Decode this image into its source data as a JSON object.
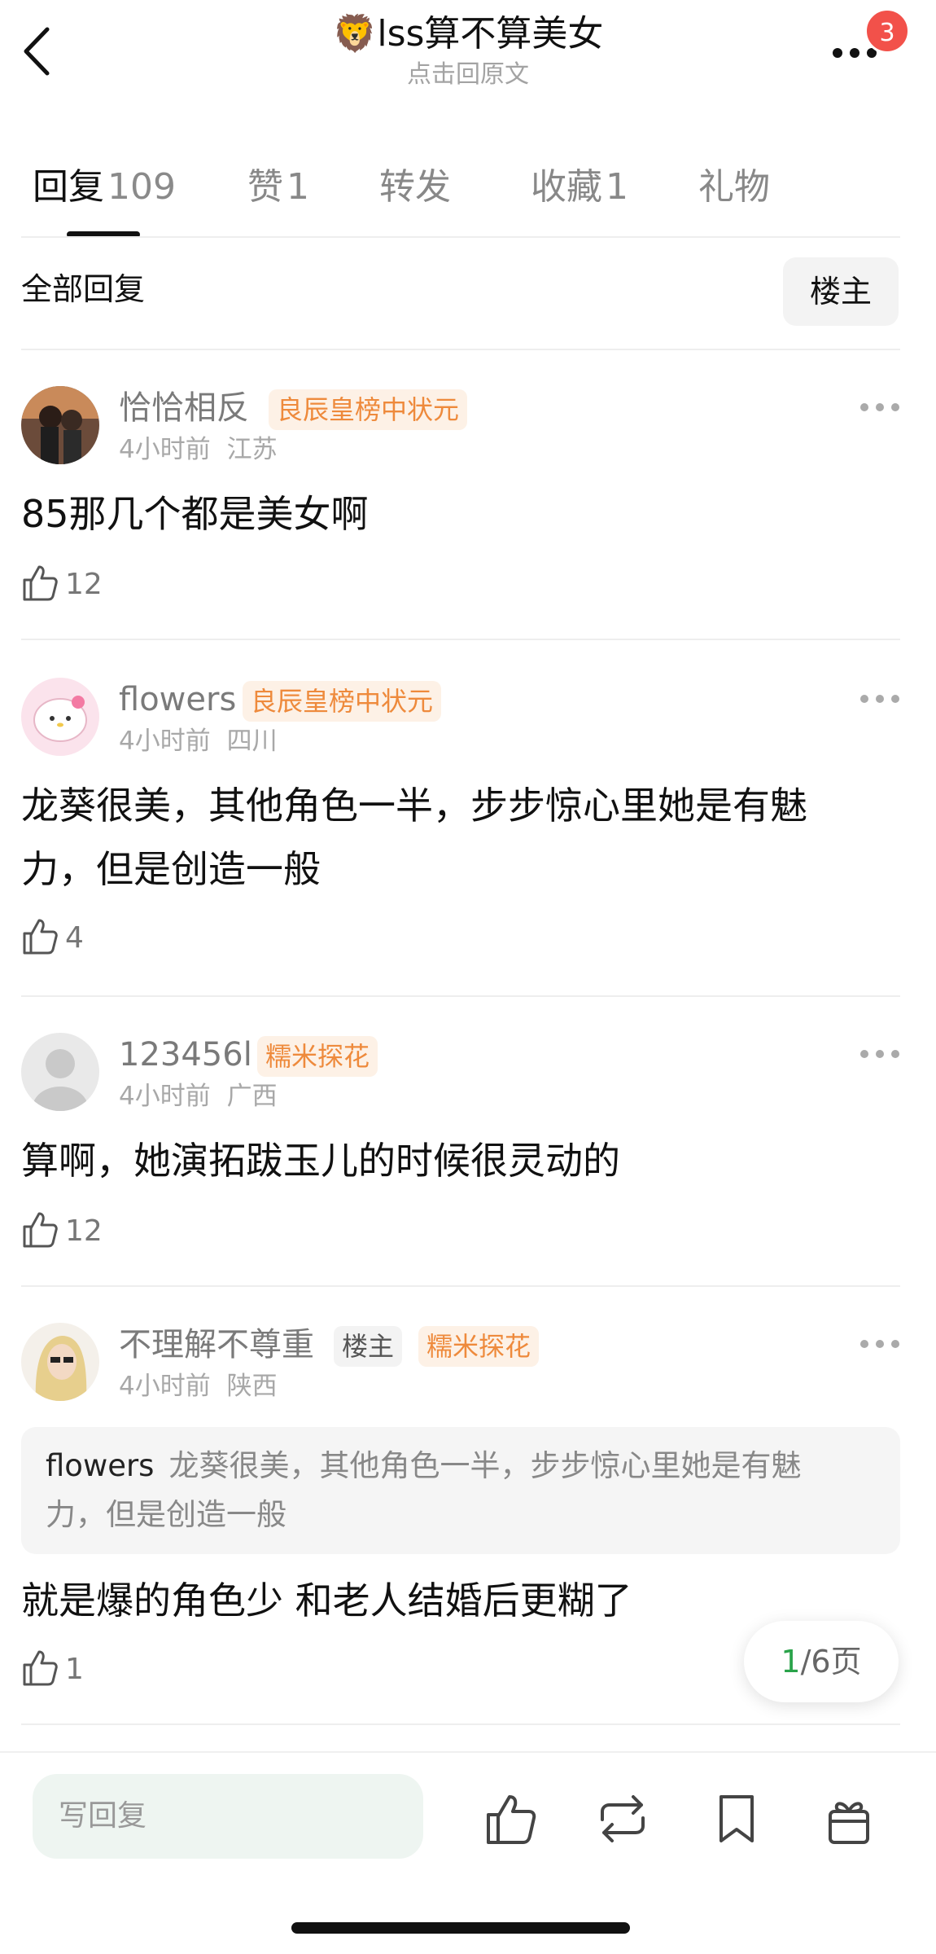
{
  "header": {
    "title_emoji": "🦁",
    "title_text": "lss算不算美女",
    "subtitle": "点击回原文",
    "notification_count": "3"
  },
  "tabs": [
    {
      "label": "回复",
      "count": "109"
    },
    {
      "label": "赞",
      "count": "1"
    },
    {
      "label": "转发",
      "count": ""
    },
    {
      "label": "收藏",
      "count": "1"
    },
    {
      "label": "礼物",
      "count": ""
    }
  ],
  "filter": {
    "label": "全部回复",
    "owner_button": "楼主"
  },
  "comments": [
    {
      "user": "恰恰相反",
      "tags": [
        "良辰皇榜中状元"
      ],
      "time": "4小时前",
      "location": "江苏",
      "text": "85那几个都是美女啊",
      "likes": "12"
    },
    {
      "user": "flowers",
      "tags": [
        "良辰皇榜中状元"
      ],
      "time": "4小时前",
      "location": "四川",
      "text_line1": "龙葵很美，其他角色一半，步步惊心里她是有魅",
      "text_line2": "力，但是创造一般",
      "likes": "4"
    },
    {
      "user": "123456l",
      "tags": [
        "糯米探花"
      ],
      "time": "4小时前",
      "location": "广西",
      "text": "算啊，她演拓跋玉儿的时候很灵动的",
      "likes": "12"
    },
    {
      "user": "不理解不尊重",
      "tags": [
        "楼主",
        "糯米探花"
      ],
      "time": "4小时前",
      "location": "陕西",
      "quote_user": "flowers",
      "quote_line1": "龙葵很美，其他角色一半，步步惊心里她是有魅",
      "quote_line2": "力，但是创造一般",
      "text": "就是爆的角色少 和老人结婚后更糊了",
      "likes": "1"
    }
  ],
  "pager": {
    "current": "1",
    "total": "/6页"
  },
  "bottom": {
    "reply_placeholder": "写回复"
  },
  "colors": {
    "accent_green": "#2aa34a",
    "tag_orange": "#ee8a3c",
    "badge_red": "#f2514a"
  }
}
